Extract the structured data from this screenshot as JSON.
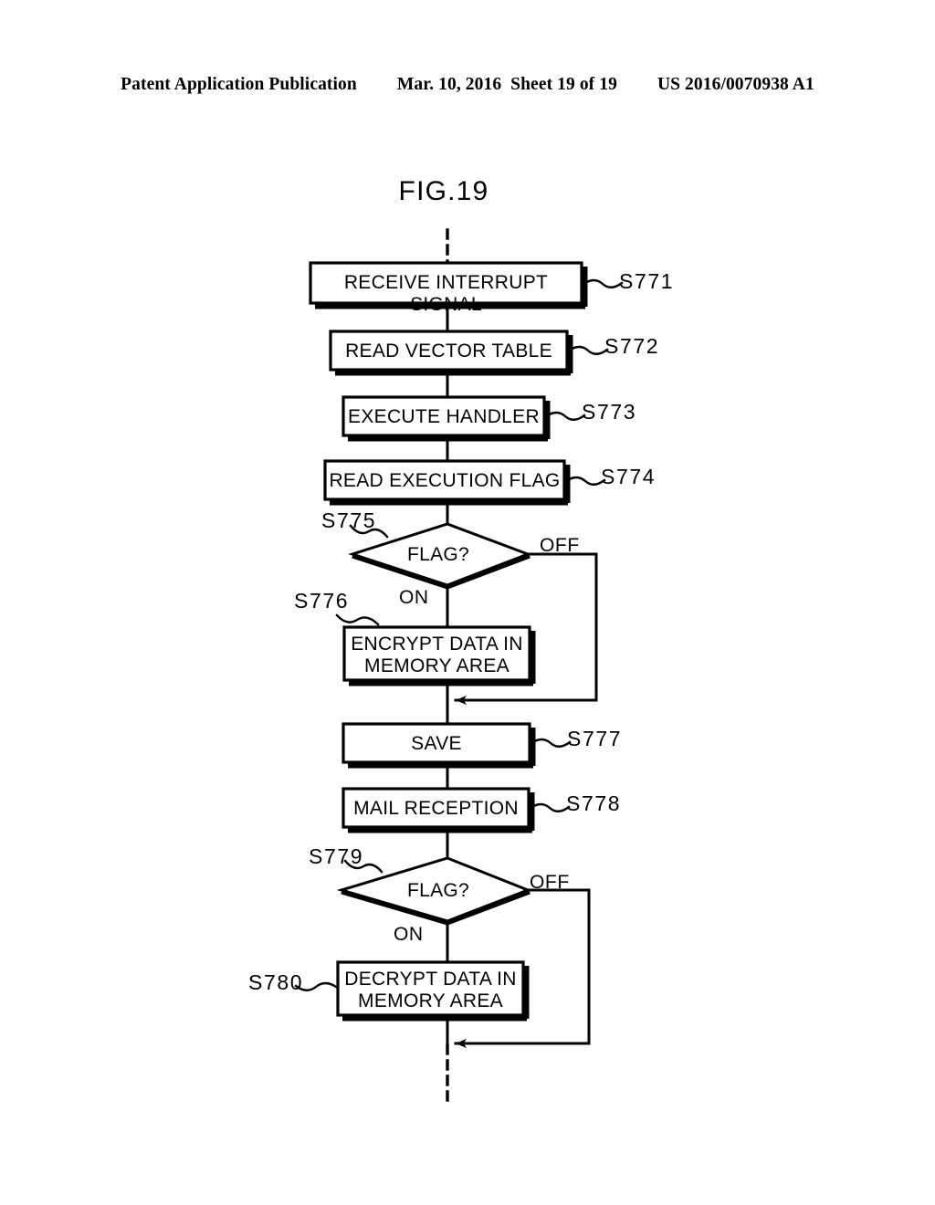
{
  "header": {
    "publication": "Patent Application Publication",
    "date": "Mar. 10, 2016",
    "sheet": "Sheet 19 of 19",
    "patent_number": "US 2016/0070938 A1"
  },
  "figure": {
    "title": "FIG.19",
    "type": "flowchart",
    "entry_connector": "dashed",
    "exit_connector": "dashed"
  },
  "flowchart": {
    "nodes": [
      {
        "id": "s771",
        "shape": "process",
        "label": "RECEIVE INTERRUPT SIGNAL",
        "step": "S771"
      },
      {
        "id": "s772",
        "shape": "process",
        "label": "READ VECTOR TABLE",
        "step": "S772"
      },
      {
        "id": "s773",
        "shape": "process",
        "label": "EXECUTE HANDLER",
        "step": "S773"
      },
      {
        "id": "s774",
        "shape": "process",
        "label": "READ EXECUTION FLAG",
        "step": "S774"
      },
      {
        "id": "s775",
        "shape": "decision",
        "label": "FLAG?",
        "step": "S775"
      },
      {
        "id": "s776",
        "shape": "process",
        "label": "ENCRYPT DATA IN\nMEMORY AREA",
        "step": "S776"
      },
      {
        "id": "s777",
        "shape": "process",
        "label": "SAVE",
        "step": "S777"
      },
      {
        "id": "s778",
        "shape": "process",
        "label": "MAIL RECEPTION",
        "step": "S778"
      },
      {
        "id": "s779",
        "shape": "decision",
        "label": "FLAG?",
        "step": "S779"
      },
      {
        "id": "s780",
        "shape": "process",
        "label": "DECRYPT DATA IN\nMEMORY AREA",
        "step": "S780"
      }
    ],
    "branch_labels": {
      "s775_on": "ON",
      "s775_off": "OFF",
      "s779_on": "ON",
      "s779_off": "OFF"
    },
    "colors": {
      "ink": "#000000",
      "paper": "#ffffff"
    }
  }
}
